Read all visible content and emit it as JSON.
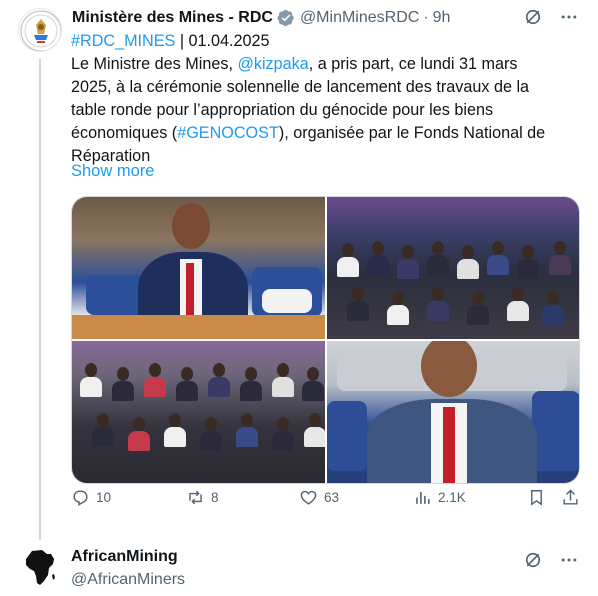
{
  "tweet": {
    "author_name": "Ministère des Mines - RDC",
    "author_handle": "@MinMinesRDC",
    "separator": "·",
    "time": "9h",
    "text_lines": [
      [
        {
          "t": "#RDC_MINES",
          "link": true
        },
        {
          "t": " | 01.04.2025",
          "link": false
        }
      ],
      [
        {
          "t": "Le Ministre des Mines, ",
          "link": false
        },
        {
          "t": "@kizpaka",
          "link": true
        },
        {
          "t": ", a pris part, ce lundi 31 mars",
          "link": false
        }
      ],
      [
        {
          "t": "2025, à la cérémonie solennelle de lancement des travaux de la",
          "link": false
        }
      ],
      [
        {
          "t": "table ronde pour l’appropriation du génocide pour les biens",
          "link": false
        }
      ],
      [
        {
          "t": "économiques (",
          "link": false
        },
        {
          "t": "#GENOCOST",
          "link": true
        },
        {
          "t": "), organisée par le Fonds National de",
          "link": false
        }
      ],
      [
        {
          "t": "Réparation",
          "link": false
        }
      ]
    ],
    "show_more": "Show more",
    "stats": {
      "replies": "10",
      "reposts": "8",
      "likes": "63",
      "views": "2.1K"
    },
    "icons": {
      "top_right": [
        "grok-icon",
        "more-icon"
      ],
      "actions": [
        "reply-icon",
        "repost-icon",
        "like-icon",
        "views-icon",
        "bookmark-icon",
        "share-icon"
      ]
    }
  },
  "next_tweet": {
    "author_name": "AfricanMining",
    "author_handle": "@AfricanMiners"
  },
  "colors": {
    "link": "#1d9bf0",
    "muted": "#536471",
    "text": "#0f1419",
    "verified": "#829aab"
  }
}
